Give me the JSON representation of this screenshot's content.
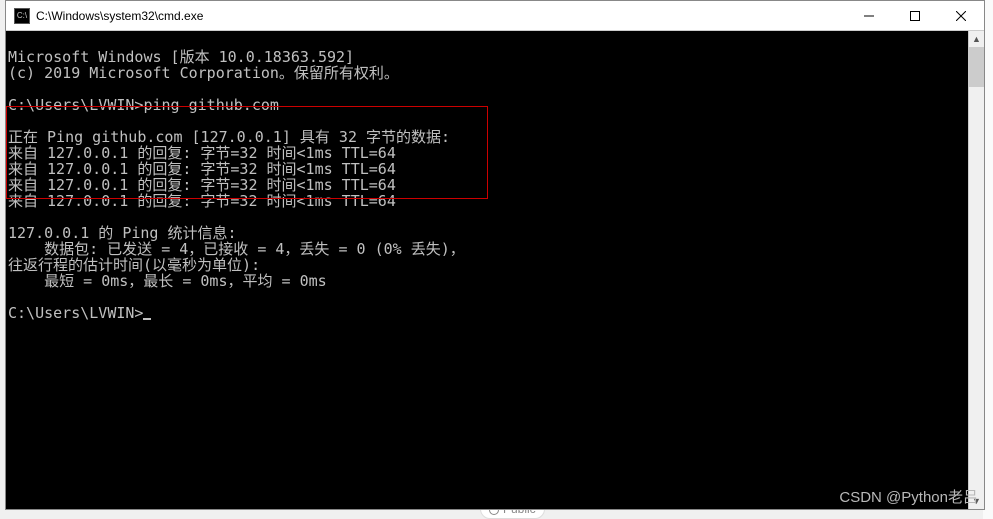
{
  "window": {
    "icon_label": "C:\\",
    "title": "C:\\Windows\\system32\\cmd.exe"
  },
  "terminal": {
    "line1": "Microsoft Windows [版本 10.0.18363.592]",
    "line2": "(c) 2019 Microsoft Corporation。保留所有权利。",
    "blank1": "",
    "prompt1": "C:\\Users\\LVWIN>ping github.com",
    "blank2": "",
    "ping_header": "正在 Ping github.com [127.0.0.1] 具有 32 字节的数据:",
    "reply1": "来自 127.0.0.1 的回复: 字节=32 时间<1ms TTL=64",
    "reply2": "来自 127.0.0.1 的回复: 字节=32 时间<1ms TTL=64",
    "reply3": "来自 127.0.0.1 的回复: 字节=32 时间<1ms TTL=64",
    "reply4": "来自 127.0.0.1 的回复: 字节=32 时间<1ms TTL=64",
    "blank3": "",
    "stats_header": "127.0.0.1 的 Ping 统计信息:",
    "stats_packets": "    数据包: 已发送 = 4，已接收 = 4，丢失 = 0 (0% 丢失)，",
    "stats_rt_header": "往返行程的估计时间(以毫秒为单位):",
    "stats_rt": "    最短 = 0ms，最长 = 0ms，平均 = 0ms",
    "blank4": "",
    "prompt2": "C:\\Users\\LVWIN>"
  },
  "watermark": "CSDN @Python老吕",
  "bg_text": "Public"
}
